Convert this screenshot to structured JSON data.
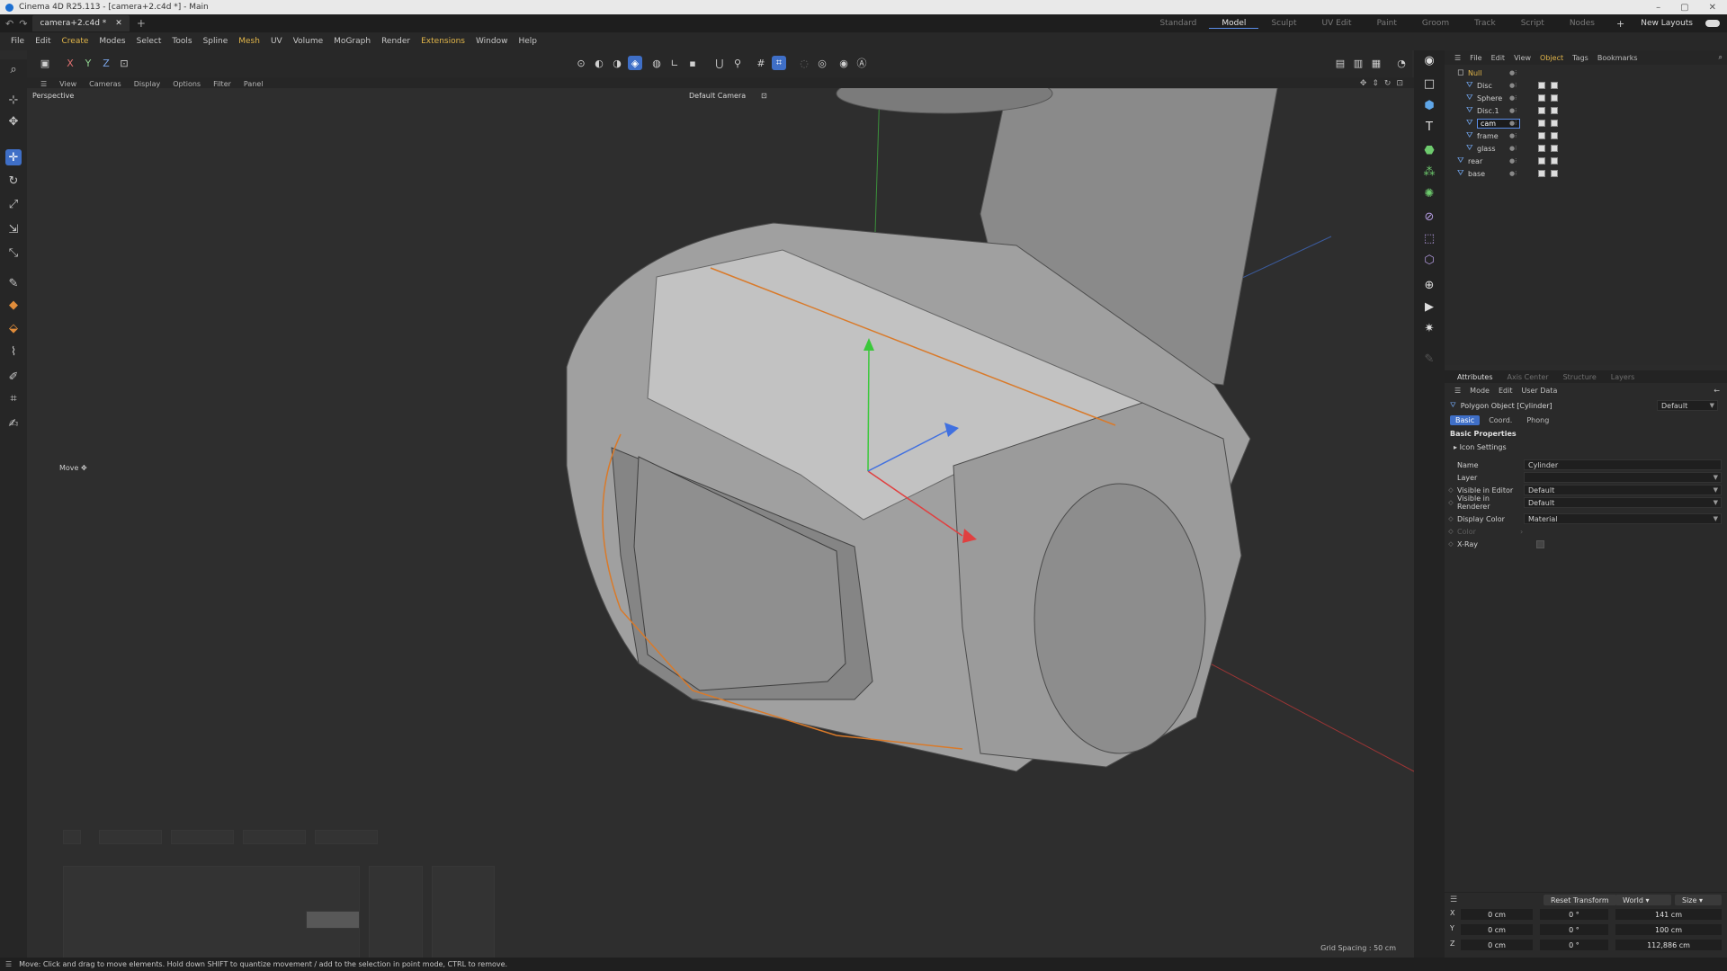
{
  "window": {
    "title": "Cinema 4D R25.113 - [camera+2.c4d *] - Main",
    "controls": [
      "–",
      "▢",
      "✕"
    ]
  },
  "tabs": {
    "document": "camera+2.c4d *",
    "layouts": [
      "Standard",
      "Model",
      "Sculpt",
      "UV Edit",
      "Paint",
      "Groom",
      "Track",
      "Script",
      "Nodes"
    ],
    "active_layout": "Model",
    "new_layouts": "New Layouts"
  },
  "menu": [
    "File",
    "Edit",
    "Create",
    "Modes",
    "Select",
    "Tools",
    "Spline",
    "Mesh",
    "UV",
    "Volume",
    "MoGraph",
    "Render",
    "Extensions",
    "Window",
    "Help"
  ],
  "viewport": {
    "menu": [
      "View",
      "Cameras",
      "Display",
      "Options",
      "Filter",
      "Panel"
    ],
    "view_name": "Perspective",
    "camera": "Default Camera",
    "hud": "Move",
    "grid_spacing": "Grid Spacing : 50 cm"
  },
  "object_manager": {
    "menu": [
      "File",
      "Edit",
      "View",
      "Object",
      "Tags",
      "Bookmarks"
    ],
    "objects": [
      {
        "name": "Null",
        "level": 0
      },
      {
        "name": "Disc",
        "level": 1
      },
      {
        "name": "Sphere",
        "level": 1
      },
      {
        "name": "Disc.1",
        "level": 1
      },
      {
        "name": "cam",
        "level": 1
      },
      {
        "name": "frame",
        "level": 1
      },
      {
        "name": "glass",
        "level": 1
      },
      {
        "name": "rear",
        "level": 0
      },
      {
        "name": "base",
        "level": 0
      }
    ]
  },
  "attributes": {
    "tabs": [
      "Attributes",
      "Axis Center",
      "Structure",
      "Layers"
    ],
    "menu": [
      "Mode",
      "Edit",
      "User Data"
    ],
    "object_title": "Polygon Object [Cylinder]",
    "preset": "Default",
    "subtabs": [
      "Basic",
      "Coord.",
      "Phong"
    ],
    "section": "Basic Properties",
    "subsection": "Icon Settings",
    "props": {
      "name_label": "Name",
      "name_value": "Cylinder",
      "layer_label": "Layer",
      "vis_editor_label": "Visible in Editor",
      "vis_editor_value": "Default",
      "vis_render_label": "Visible in Renderer",
      "vis_render_value": "Default",
      "display_color_label": "Display Color",
      "display_color_value": "Material",
      "color_label": "Color",
      "xray_label": "X-Ray"
    }
  },
  "coordinates": {
    "reset": "Reset Transform",
    "space": "World",
    "mode": "Size",
    "rows": [
      {
        "axis": "X",
        "pos": "0 cm",
        "rot": "0 °",
        "size": "141 cm"
      },
      {
        "axis": "Y",
        "pos": "0 cm",
        "rot": "0 °",
        "size": "100 cm"
      },
      {
        "axis": "Z",
        "pos": "0 cm",
        "rot": "0 °",
        "size": "112,886 cm"
      }
    ]
  },
  "status": "Move: Click and drag to move elements. Hold down SHIFT to quantize movement / add to the selection in point mode, CTRL to remove.",
  "colors": {
    "accent": "#3f6fc7",
    "highlight_menu": "#e2b64a",
    "selection_edge": "#d97a2a"
  }
}
